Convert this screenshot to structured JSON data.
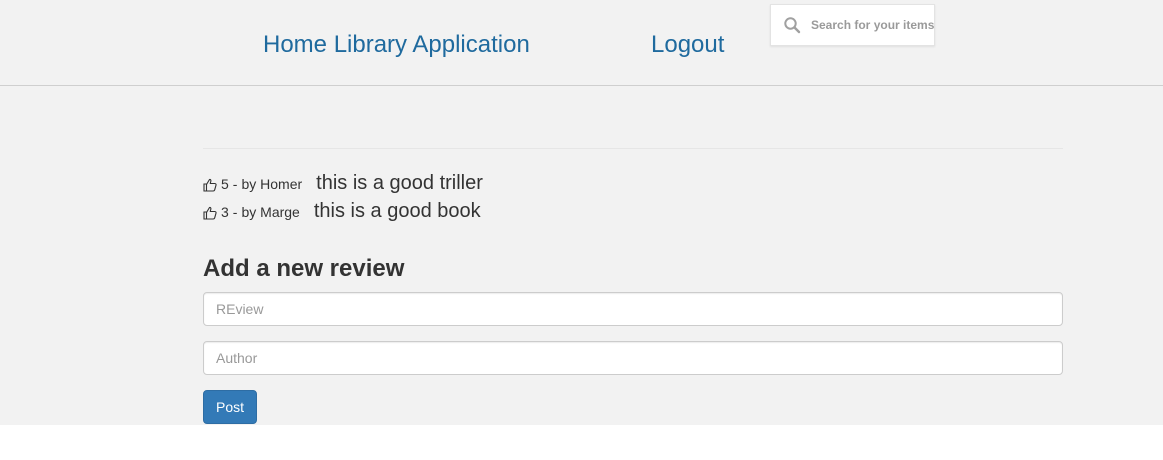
{
  "navbar": {
    "brand": "Home Library Application",
    "logout": "Logout",
    "search_placeholder": "Search for your items"
  },
  "reviews": [
    {
      "rating": "5",
      "separator": "-",
      "by_label": "by",
      "author": "Homer",
      "text": "this is a good triller"
    },
    {
      "rating": "3",
      "separator": "-",
      "by_label": "by",
      "author": "Marge",
      "text": "this is a good book"
    }
  ],
  "form": {
    "title": "Add a new review",
    "review_placeholder": "REview",
    "author_placeholder": "Author",
    "post_label": "Post"
  },
  "icons": {
    "search": "search-icon",
    "thumbs_up": "thumbs-up-icon"
  },
  "colors": {
    "link": "#1f6a9e",
    "primary_button": "#337ab7",
    "background": "#f2f2f2"
  }
}
